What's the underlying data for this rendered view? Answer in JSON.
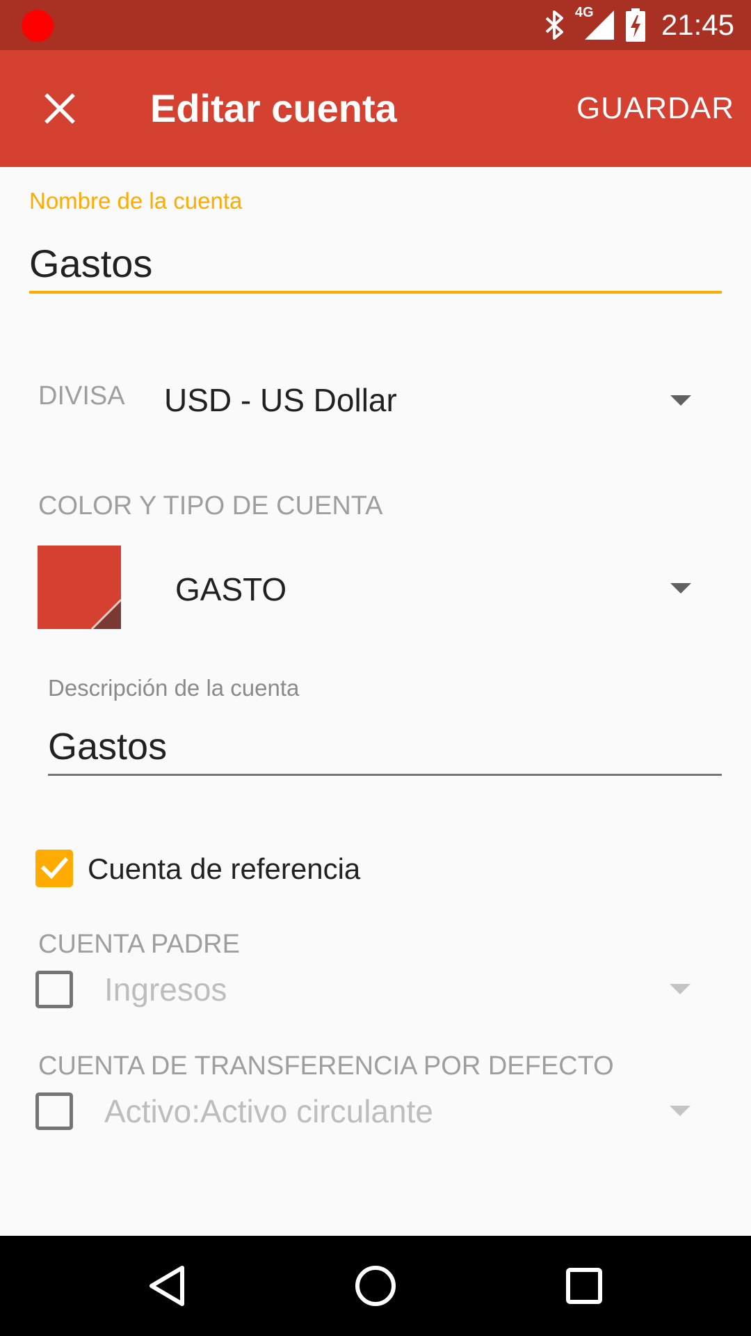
{
  "status_bar": {
    "time": "21:45",
    "network": "4G"
  },
  "app_bar": {
    "title": "Editar cuenta",
    "save_label": "GUARDAR"
  },
  "account_name": {
    "label": "Nombre de la cuenta",
    "value": "Gastos"
  },
  "currency": {
    "label": "DIVISA",
    "value": "USD - US Dollar"
  },
  "color_type": {
    "label": "COLOR Y TIPO DE CUENTA",
    "color": "#d44130",
    "type_value": "GASTO"
  },
  "description": {
    "label": "Descripción de la cuenta",
    "value": "Gastos"
  },
  "placeholder_account": {
    "label": "Cuenta de referencia",
    "checked": true
  },
  "parent_account": {
    "label": "CUENTA PADRE",
    "checked": false,
    "value": "Ingresos"
  },
  "default_transfer": {
    "label": "CUENTA DE TRANSFERENCIA POR DEFECTO",
    "checked": false,
    "value": "Activo:Activo circulante"
  },
  "colors": {
    "status_bar": "#a83123",
    "app_bar": "#d44130",
    "accent": "#ffab00",
    "recording_indicator": "#ff0000"
  },
  "icons": {
    "close": "close-icon",
    "bluetooth": "bluetooth-icon",
    "signal": "signal-icon",
    "battery": "battery-charging-icon",
    "dropdown": "dropdown-arrow-icon",
    "check": "check-icon",
    "back": "back-icon",
    "home": "home-icon",
    "recents": "recents-icon"
  }
}
